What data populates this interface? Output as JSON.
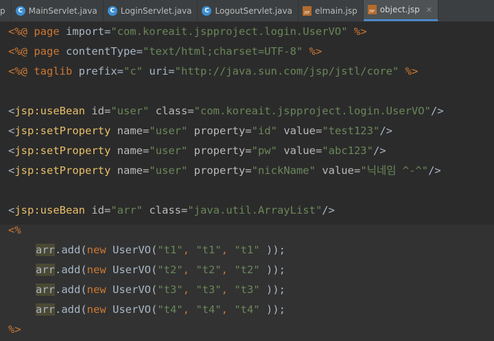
{
  "tabs": [
    {
      "label": "p",
      "icon": "none"
    },
    {
      "label": "MainServlet.java",
      "icon": "java-class-icon"
    },
    {
      "label": "LoginServlet.java",
      "icon": "java-class-icon"
    },
    {
      "label": "LogoutServlet.java",
      "icon": "java-class-icon"
    },
    {
      "label": "elmain.jsp",
      "icon": "jsp-file-icon"
    },
    {
      "label": "object.jsp",
      "icon": "jsp-file-icon",
      "active": true,
      "close": "✕"
    }
  ],
  "code": {
    "l1": {
      "d1": "<%@ ",
      "k": "page",
      "a": " import=",
      "s": "\"com.koreait.jspproject.login.UserVO\"",
      "d2": " %>"
    },
    "l2": {
      "d1": "<%@ ",
      "k": "page",
      "a": " contentType=",
      "s": "\"text/html;charset=UTF-8\"",
      "d2": " %>"
    },
    "l3": {
      "d1": "<%@ ",
      "k": "taglib",
      "a1": " prefix=",
      "s1": "\"c\"",
      "a2": " uri=",
      "s2": "\"http://java.sun.com/jsp/jstl/core\"",
      "d2": " %>"
    },
    "l4": {
      "lt": "<",
      "tag": "jsp:useBean",
      "a1": " id=",
      "s1": "\"user\"",
      "a2": " class=",
      "s2": "\"com.koreait.jspproject.login.UserVO\"",
      "end": "/>"
    },
    "l5": {
      "lt": "<",
      "tag": "jsp:setProperty",
      "a1": " name=",
      "s1": "\"user\"",
      "a2": " property=",
      "s2": "\"id\"",
      "a3": " value=",
      "s3": "\"test123\"",
      "end": "/>"
    },
    "l6": {
      "lt": "<",
      "tag": "jsp:setProperty",
      "a1": " name=",
      "s1": "\"user\"",
      "a2": " property=",
      "s2": "\"pw\"",
      "a3": " value=",
      "s3": "\"abc123\"",
      "end": "/>"
    },
    "l7": {
      "lt": "<",
      "tag": "jsp:setProperty",
      "a1": " name=",
      "s1": "\"user\"",
      "a2": " property=",
      "s2": "\"nickName\"",
      "a3": " value=",
      "s3": "\"닉네임 ^-^\"",
      "end": "/>"
    },
    "l8": {
      "lt": "<",
      "tag": "jsp:useBean",
      "a1": " id=",
      "s1": "\"arr\"",
      "a2": " class=",
      "s2": "\"java.util.ArrayList\"",
      "end": "/>"
    },
    "l9": {
      "d": "<%"
    },
    "l10": {
      "var": "arr",
      "m": ".add(",
      "k": "new",
      "c": " UserVO(",
      "s1": "\"t1\"",
      "s2": "\"t1\"",
      "s3": "\"t1\"",
      "end": " ));"
    },
    "l11": {
      "var": "arr",
      "m": ".add(",
      "k": "new",
      "c": " UserVO(",
      "s1": "\"t2\"",
      "s2": "\"t2\"",
      "s3": "\"t2\"",
      "end": " ));"
    },
    "l12": {
      "var": "arr",
      "m": ".add(",
      "k": "new",
      "c": " UserVO(",
      "s1": "\"t3\"",
      "s2": "\"t3\"",
      "s3": "\"t3\"",
      "end": " ));"
    },
    "l13": {
      "var": "arr",
      "m": ".add(",
      "k": "new",
      "c": " UserVO(",
      "s1": "\"t4\"",
      "s2": "\"t4\"",
      "s3": "\"t4\"",
      "end": " ));"
    },
    "l14": {
      "d": "%>"
    }
  },
  "comma": ", ",
  "colors": {
    "background": "#2b2b2b",
    "keyword": "#cc7832",
    "string": "#6a8759",
    "tag": "#e8bf6a",
    "text": "#a9b7c6"
  }
}
